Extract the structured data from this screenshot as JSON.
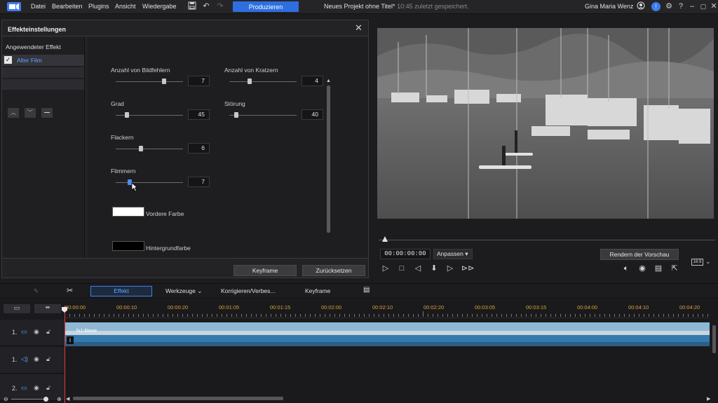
{
  "menu": {
    "items": [
      "Datei",
      "Bearbeiten",
      "Plugins",
      "Ansicht",
      "Wiedergabe"
    ],
    "produce": "Produzieren"
  },
  "title_bar": {
    "project": "Neues Projekt ohne Titel*",
    "saved": "10:45 zuletzt gespeichert.",
    "user": "Gina Maria Wenz"
  },
  "effect_panel": {
    "title": "Effekteinstellungen",
    "applied_label": "Angewendeter Effekt",
    "applied_item": "Alter Film",
    "params": [
      {
        "label": "Anzahl von Bildfehlern",
        "value": "7",
        "fraction": 0.72
      },
      {
        "label": "Anzahl von Kratzern",
        "value": "4",
        "fraction": 0.3
      },
      {
        "label": "Grad",
        "value": "45",
        "fraction": 0.17
      },
      {
        "label": "Störung",
        "value": "40",
        "fraction": 0.1
      },
      {
        "label": "Flackern",
        "value": "6",
        "fraction": 0.37
      },
      {
        "label": "Flimmern",
        "value": "7",
        "fraction": 0.21
      }
    ],
    "front_color_label": "Vordere Farbe",
    "front_color": "#ffffff",
    "bg_color_label": "Hintergrundfarbe",
    "bg_color": "#000000",
    "keyframe_btn": "Keyframe",
    "reset_btn": "Zurücksetzen"
  },
  "preview": {
    "timecode": "00:00:00:00",
    "fit": "Anpassen",
    "render_btn": "Rendern der Vorschau",
    "ratio": "16:9"
  },
  "toolbar": {
    "effect": "Effekt",
    "tools": "Werkzeuge",
    "correct": "Korrigieren/Verbes...",
    "keyframe": "Keyframe"
  },
  "timeline": {
    "ticks": [
      "00:00:00",
      "00:00:10",
      "00:00:20",
      "00:01:05",
      "00:01:15",
      "00:02:00",
      "00:02:10",
      "00:02:20",
      "00:03:05",
      "00:03:15",
      "00:04:00",
      "00:04:10",
      "00:04:20"
    ],
    "tracks": [
      {
        "name": "1.",
        "type": "video"
      },
      {
        "name": "1.",
        "type": "audio"
      },
      {
        "name": "2.",
        "type": "video"
      }
    ],
    "clip_label": "fx1-Bewe"
  },
  "accent": "#2d6fe0"
}
